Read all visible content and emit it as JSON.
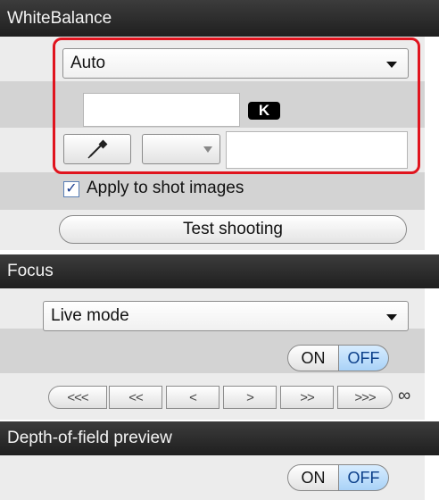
{
  "white_balance": {
    "title": "WhiteBalance",
    "preset": "Auto",
    "kelvin_value": "",
    "kelvin_badge": "K",
    "shift_select": "",
    "shift_value": "",
    "apply_to_shot_checked": true,
    "apply_to_shot_label": "Apply to shot images",
    "test_shooting_label": "Test shooting"
  },
  "focus": {
    "title": "Focus",
    "mode": "Live mode",
    "on_label": "ON",
    "off_label": "OFF",
    "selected": "OFF",
    "steps": [
      "<<<",
      "<<",
      "<",
      ">",
      ">>",
      ">>>"
    ],
    "infinity": "∞"
  },
  "dof_preview": {
    "title": "Depth-of-field preview",
    "on_label": "ON",
    "off_label": "OFF",
    "selected": "OFF"
  },
  "colors": {
    "header_bg": "#2a2a2a",
    "highlight_frame": "#e0141e",
    "selected_toggle": "#b9dcfb"
  }
}
